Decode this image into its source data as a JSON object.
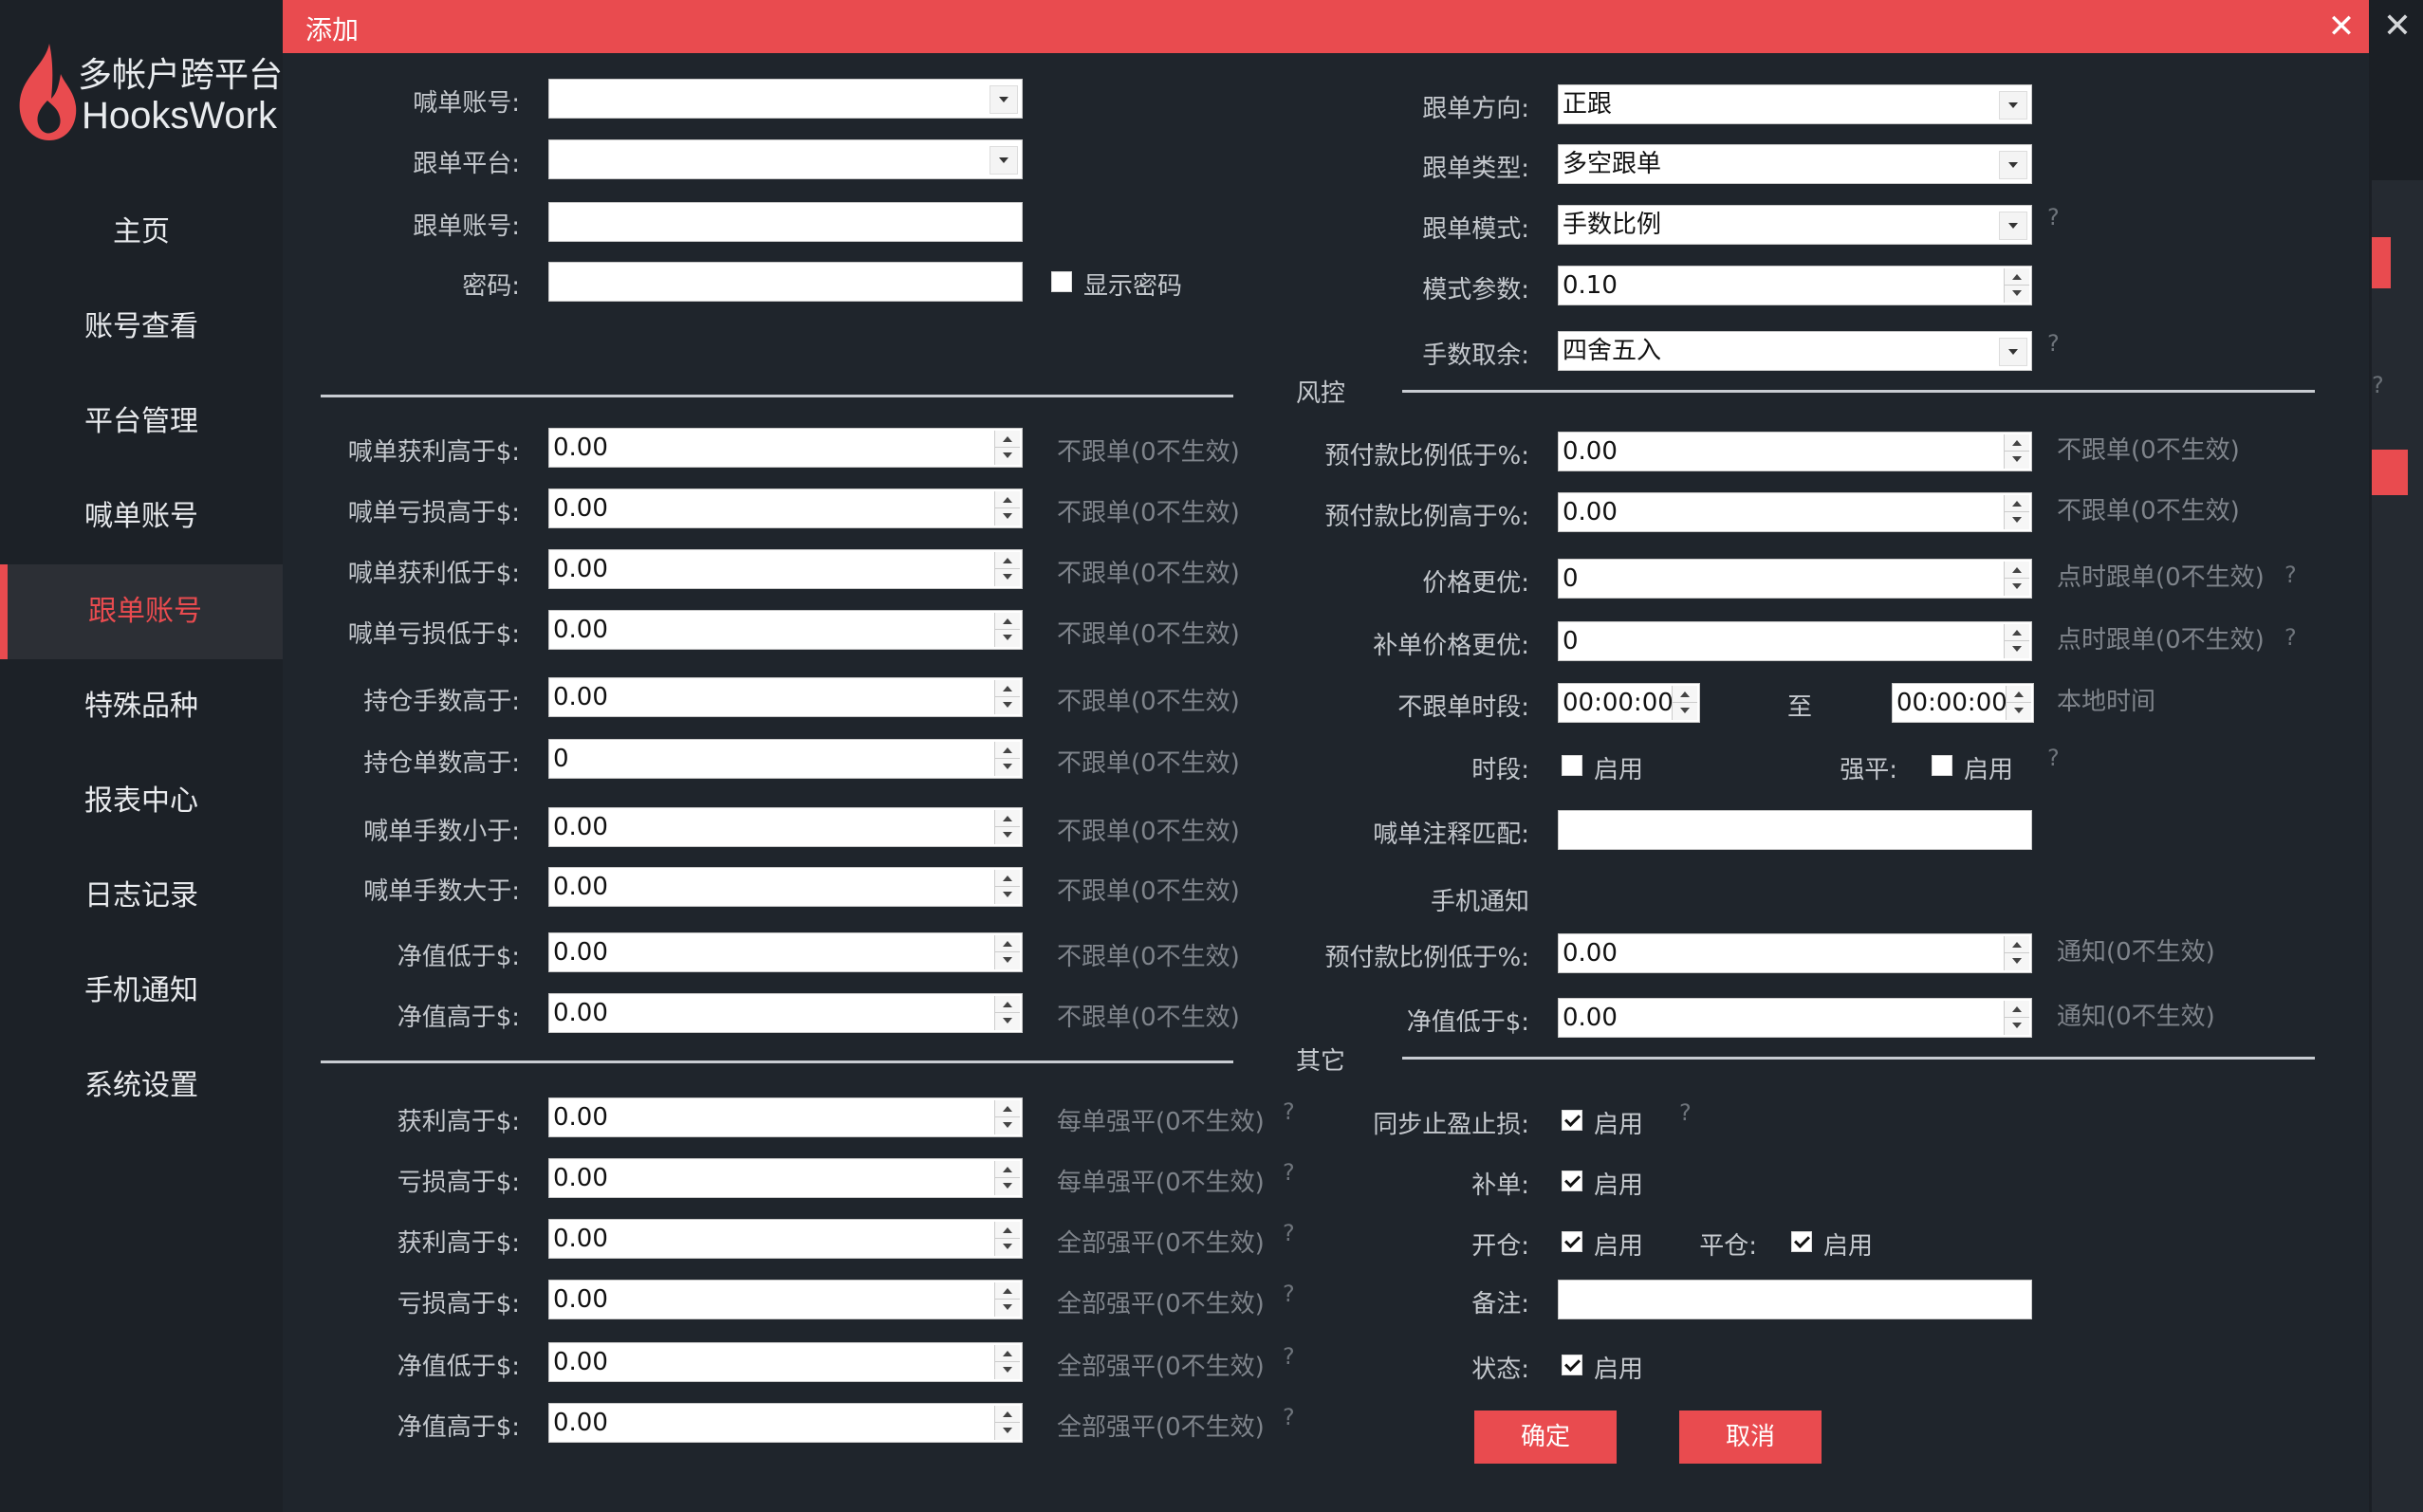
{
  "brand": {
    "line1": "多帐户跨平台",
    "line2": "HooksWork",
    "color": "#e94b4f"
  },
  "nav": [
    {
      "label": "主页"
    },
    {
      "label": "账号查看"
    },
    {
      "label": "平台管理"
    },
    {
      "label": "喊单账号"
    },
    {
      "label": "跟单账号",
      "active": true
    },
    {
      "label": "特殊品种"
    },
    {
      "label": "报表中心"
    },
    {
      "label": "日志记录"
    },
    {
      "label": "手机通知"
    },
    {
      "label": "系统设置"
    }
  ],
  "dialog": {
    "title": "添加",
    "close_icon": "close-icon"
  },
  "left_top": [
    {
      "label": "喊单账号:",
      "type": "select",
      "value": ""
    },
    {
      "label": "跟单平台:",
      "type": "select",
      "value": ""
    },
    {
      "label": "跟单账号:",
      "type": "text",
      "value": ""
    },
    {
      "label": "密码:",
      "type": "text",
      "value": ""
    }
  ],
  "show_password": {
    "label": "显示密码",
    "checked": false
  },
  "right_top": [
    {
      "label": "跟单方向:",
      "type": "select",
      "value": "正跟"
    },
    {
      "label": "跟单类型:",
      "type": "select",
      "value": "多空跟单"
    },
    {
      "label": "跟单模式:",
      "type": "select",
      "value": "手数比例",
      "help": "?"
    },
    {
      "label": "模式参数:",
      "type": "spin",
      "value": "0.10"
    },
    {
      "label": "手数取余:",
      "type": "select",
      "value": "四舍五入",
      "help": "?"
    }
  ],
  "section_risk": "风控",
  "left_risk": [
    {
      "label": "喊单获利高于$:",
      "value": "0.00",
      "hint": "不跟单(0不生效)"
    },
    {
      "label": "喊单亏损高于$:",
      "value": "0.00",
      "hint": "不跟单(0不生效)"
    },
    {
      "label": "喊单获利低于$:",
      "value": "0.00",
      "hint": "不跟单(0不生效)"
    },
    {
      "label": "喊单亏损低于$:",
      "value": "0.00",
      "hint": "不跟单(0不生效)"
    },
    {
      "label": "持仓手数高于:",
      "value": "0.00",
      "hint": "不跟单(0不生效)"
    },
    {
      "label": "持仓单数高于:",
      "value": "0",
      "hint": "不跟单(0不生效)"
    },
    {
      "label": "喊单手数小于:",
      "value": "0.00",
      "hint": "不跟单(0不生效)"
    },
    {
      "label": "喊单手数大于:",
      "value": "0.00",
      "hint": "不跟单(0不生效)"
    },
    {
      "label": "净值低于$:",
      "value": "0.00",
      "hint": "不跟单(0不生效)"
    },
    {
      "label": "净值高于$:",
      "value": "0.00",
      "hint": "不跟单(0不生效)"
    }
  ],
  "right_risk": [
    {
      "label": "预付款比例低于%:",
      "value": "0.00",
      "hint": "不跟单(0不生效)"
    },
    {
      "label": "预付款比例高于%:",
      "value": "0.00",
      "hint": "不跟单(0不生效)"
    },
    {
      "label": "价格更优:",
      "value": "0",
      "hint": "点时跟单(0不生效)",
      "help": "?"
    },
    {
      "label": "补单价格更优:",
      "value": "0",
      "hint": "点时跟单(0不生效)",
      "help": "?"
    }
  ],
  "no_follow_period": {
    "label": "不跟单时段:",
    "from": "00:00:00",
    "to_label": "至",
    "to": "00:00:00",
    "hint": "本地时间"
  },
  "period_row": {
    "label": "时段:",
    "enable": "启用",
    "force_label": "强平:",
    "force_enable": "启用",
    "help": "?"
  },
  "comment_match": {
    "label": "喊单注释匹配:",
    "value": ""
  },
  "phone_notify": {
    "title": "手机通知",
    "rows": [
      {
        "label": "预付款比例低于%:",
        "value": "0.00",
        "hint": "通知(0不生效)"
      },
      {
        "label": "净值低于$:",
        "value": "0.00",
        "hint": "通知(0不生效)"
      }
    ]
  },
  "section_other": "其它",
  "left_other": [
    {
      "label": "获利高于$:",
      "value": "0.00",
      "hint": "每单强平(0不生效)",
      "help": "?"
    },
    {
      "label": "亏损高于$:",
      "value": "0.00",
      "hint": "每单强平(0不生效)",
      "help": "?"
    },
    {
      "label": "获利高于$:",
      "value": "0.00",
      "hint": "全部强平(0不生效)",
      "help": "?"
    },
    {
      "label": "亏损高于$:",
      "value": "0.00",
      "hint": "全部强平(0不生效)",
      "help": "?"
    },
    {
      "label": "净值低于$:",
      "value": "0.00",
      "hint": "全部强平(0不生效)",
      "help": "?"
    },
    {
      "label": "净值高于$:",
      "value": "0.00",
      "hint": "全部强平(0不生效)",
      "help": "?"
    }
  ],
  "right_other": {
    "sync": {
      "label": "同步止盈止损:",
      "enable": "启用",
      "checked": true,
      "help": "?"
    },
    "supplement": {
      "label": "补单:",
      "enable": "启用",
      "checked": true
    },
    "open": {
      "label": "开仓:",
      "enable": "启用",
      "checked": true
    },
    "close": {
      "label": "平仓:",
      "enable": "启用",
      "checked": true
    },
    "remark": {
      "label": "备注:",
      "value": ""
    },
    "status": {
      "label": "状态:",
      "enable": "启用",
      "checked": true
    }
  },
  "buttons": {
    "ok": "确定",
    "cancel": "取消"
  }
}
